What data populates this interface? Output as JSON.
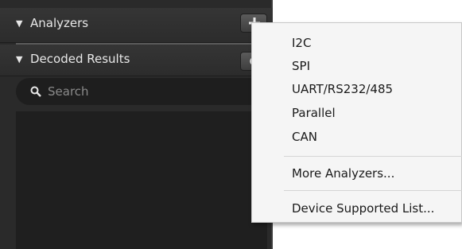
{
  "panel": {
    "analyzers": {
      "title": "Analyzers",
      "add_icon": "plus-icon"
    },
    "decoded_results": {
      "title": "Decoded Results",
      "settings_icon": "gear-icon"
    },
    "search": {
      "placeholder": "Search",
      "icon": "search-icon"
    }
  },
  "menu": {
    "items": [
      {
        "label": "I2C"
      },
      {
        "label": "SPI"
      },
      {
        "label": "UART/RS232/485"
      },
      {
        "label": "Parallel"
      },
      {
        "label": "CAN"
      },
      {
        "label": "More Analyzers..."
      },
      {
        "label": "Device Supported List..."
      }
    ]
  },
  "colors": {
    "panel_bg": "#2a2a2a",
    "menu_bg": "#f5f5f5",
    "text_light": "#e8e8e8",
    "placeholder": "#8a8a8a"
  }
}
